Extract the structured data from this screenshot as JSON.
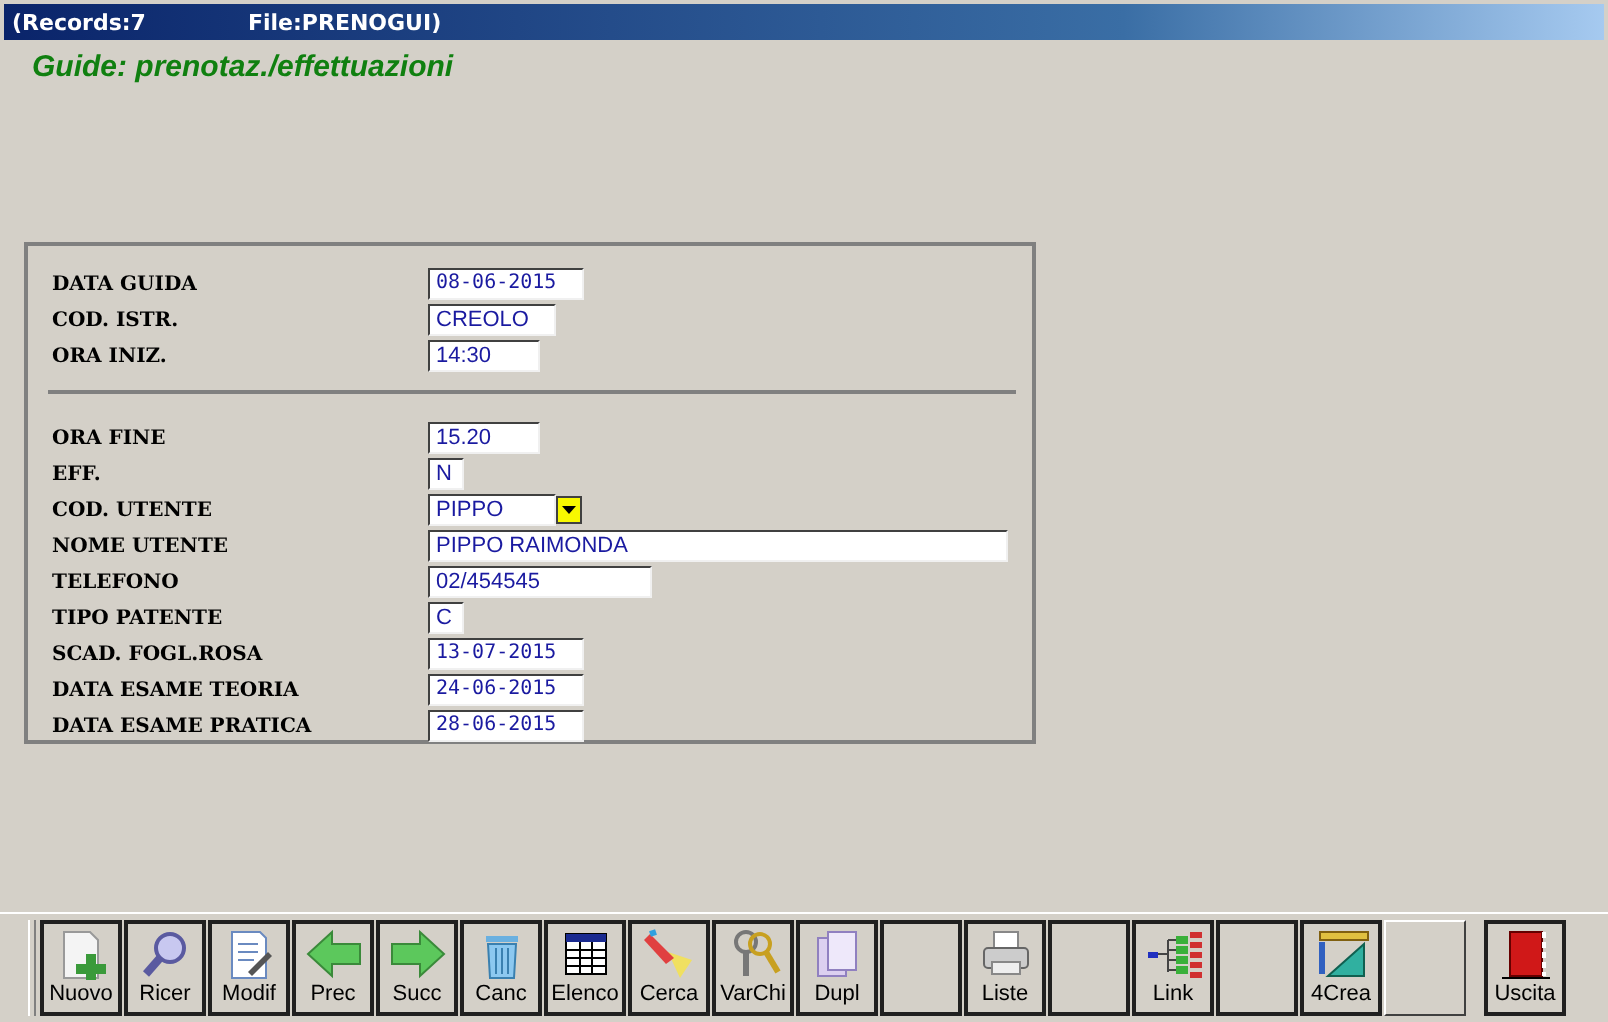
{
  "window": {
    "records": "(Records:7",
    "file": "File:PRENOGUI)"
  },
  "heading": "Guide: prenotaz./effettuazioni",
  "groups": [
    {
      "fields": [
        {
          "label": "DATA GUIDA",
          "value": "08-06-2015",
          "kind": "date"
        },
        {
          "label": "COD. ISTR.",
          "value": "CREOLO",
          "kind": "code"
        },
        {
          "label": "ORA INIZ.",
          "value": "14:30",
          "kind": "time"
        }
      ]
    },
    {
      "fields": [
        {
          "label": "ORA FINE",
          "value": "15.20",
          "kind": "time"
        },
        {
          "label": "EFF.",
          "value": "N",
          "kind": "flag"
        },
        {
          "label": "COD. UTENTE",
          "value": "PIPPO",
          "kind": "combo"
        },
        {
          "label": "NOME UTENTE",
          "value": "PIPPO RAIMONDA",
          "kind": "long"
        },
        {
          "label": "TELEFONO",
          "value": "02/454545",
          "kind": "phone"
        },
        {
          "label": "TIPO PATENTE",
          "value": "C",
          "kind": "flag"
        },
        {
          "label": "SCAD. FOGL.ROSA",
          "value": "13-07-2015",
          "kind": "date"
        },
        {
          "label": "DATA ESAME TEORIA",
          "value": "24-06-2015",
          "kind": "date"
        },
        {
          "label": "DATA ESAME PRATICA",
          "value": "28-06-2015",
          "kind": "date"
        }
      ]
    }
  ],
  "toolbar": [
    {
      "kind": "new",
      "label": "Nuovo"
    },
    {
      "kind": "search",
      "label": "Ricer"
    },
    {
      "kind": "edit",
      "label": "Modif"
    },
    {
      "kind": "prev",
      "label": "Prec"
    },
    {
      "kind": "next",
      "label": "Succ"
    },
    {
      "kind": "delete",
      "label": "Canc"
    },
    {
      "kind": "table",
      "label": "Elenco"
    },
    {
      "kind": "find",
      "label": "Cerca"
    },
    {
      "kind": "keys",
      "label": "VarChi"
    },
    {
      "kind": "copy",
      "label": "Dupl"
    },
    {
      "kind": "blank"
    },
    {
      "kind": "print",
      "label": "Liste"
    },
    {
      "kind": "blank"
    },
    {
      "kind": "tree",
      "label": "Link"
    },
    {
      "kind": "blank"
    },
    {
      "kind": "ruler",
      "label": "4Crea"
    },
    {
      "kind": "raised"
    },
    {
      "kind": "exit",
      "label": "Uscita"
    }
  ]
}
